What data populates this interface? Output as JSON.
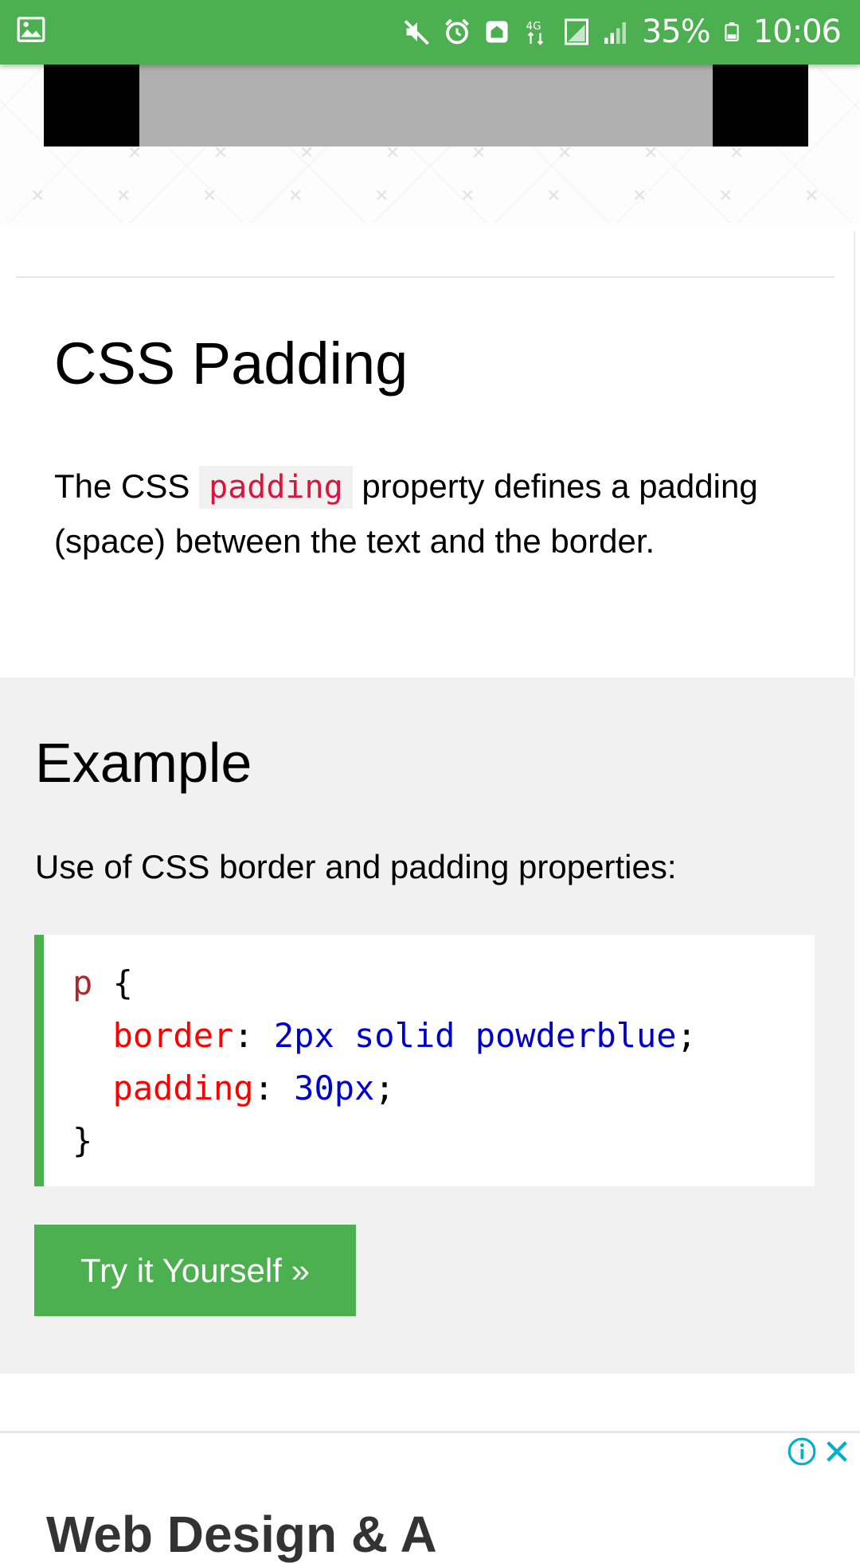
{
  "status_bar": {
    "battery_percent": "35%",
    "time": "10:06",
    "network_label": "4G",
    "icons": [
      "image-icon",
      "mute-icon",
      "alarm-icon",
      "home-signal-icon",
      "data-arrows-icon",
      "sim-icon",
      "signal-icon",
      "battery-icon"
    ]
  },
  "page": {
    "title": "CSS Padding",
    "intro_before": "The CSS ",
    "intro_code": "padding",
    "intro_after": " property defines a padding (space) between the text and the border."
  },
  "example": {
    "title": "Example",
    "description": "Use of CSS border and padding properties:",
    "code": {
      "selector": "p",
      "open_brace": " {",
      "line1_prop": "border",
      "line1_value": "2px solid powderblue",
      "line2_prop": "padding",
      "line2_value": "30px",
      "close_brace": "}"
    },
    "button_label": "Try it Yourself »"
  },
  "ad": {
    "headline": "Web Design & A"
  },
  "colors": {
    "accent_green": "#4caf50",
    "code_red": "#dc143c",
    "code_blue": "#0000cd",
    "section_gray": "#f1f1f1",
    "ad_icon_blue": "#00aecd"
  }
}
